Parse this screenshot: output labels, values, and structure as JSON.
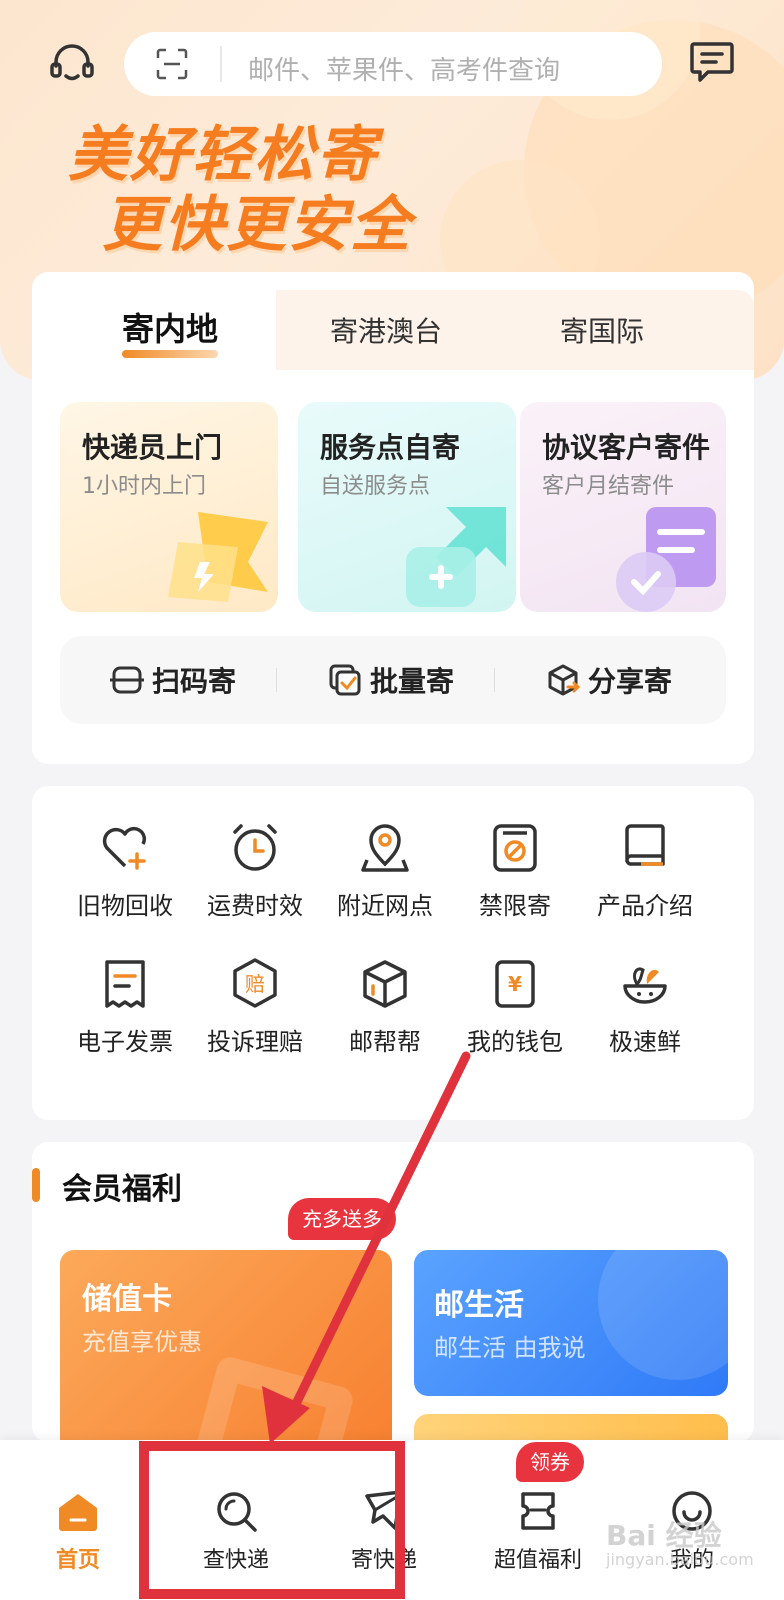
{
  "header": {
    "search_placeholder": "邮件、苹果件、高考件查询",
    "slogan_line1": "美好轻松寄",
    "slogan_line2": "更快更安全"
  },
  "send_tabs": [
    {
      "label": "寄内地",
      "active": true
    },
    {
      "label": "寄港澳台",
      "active": false
    },
    {
      "label": "寄国际",
      "active": false
    }
  ],
  "services": [
    {
      "title": "快递员上门",
      "subtitle": "1小时内上门"
    },
    {
      "title": "服务点自寄",
      "subtitle": "自送服务点"
    },
    {
      "title": "协议客户寄件",
      "subtitle": "客户月结寄件"
    }
  ],
  "quick_actions": [
    {
      "label": "扫码寄",
      "icon": "scan-icon"
    },
    {
      "label": "批量寄",
      "icon": "batch-check-icon"
    },
    {
      "label": "分享寄",
      "icon": "share-box-icon"
    }
  ],
  "grid": [
    {
      "label": "旧物回收",
      "icon": "heart-plus-icon"
    },
    {
      "label": "运费时效",
      "icon": "alarm-clock-icon"
    },
    {
      "label": "附近网点",
      "icon": "location-pin-icon"
    },
    {
      "label": "禁限寄",
      "icon": "forbidden-icon"
    },
    {
      "label": "产品介绍",
      "icon": "book-icon"
    },
    {
      "label": "电子发票",
      "icon": "invoice-icon"
    },
    {
      "label": "投诉理赔",
      "icon": "claim-icon"
    },
    {
      "label": "邮帮帮",
      "icon": "box-icon"
    },
    {
      "label": "我的钱包",
      "icon": "wallet-icon"
    },
    {
      "label": "极速鲜",
      "icon": "fresh-bowl-icon"
    }
  ],
  "claim_glyph": "赔",
  "wallet_glyph": "¥",
  "member": {
    "title": "会员福利",
    "promo_badge": "充多送多",
    "card1_title": "储值卡",
    "card1_subtitle": "充值享优惠",
    "card2_title": "邮生活",
    "card2_subtitle": "邮生活 由我说"
  },
  "tabbar": {
    "items": [
      {
        "label": "首页",
        "icon": "home-icon",
        "active": true
      },
      {
        "label": "查快递",
        "icon": "search-icon",
        "active": false
      },
      {
        "label": "寄快递",
        "icon": "send-icon",
        "active": false
      },
      {
        "label": "超值福利",
        "icon": "coupon-icon",
        "active": false
      },
      {
        "label": "我的",
        "icon": "smile-icon",
        "active": false
      }
    ],
    "coupon_badge": "领券"
  },
  "watermark": {
    "text": "Bai 经验",
    "sub": "jingyan.baidu.com"
  },
  "colors": {
    "accent": "#f08a24",
    "annotation": "#e0323c",
    "badge": "#e8343e"
  }
}
